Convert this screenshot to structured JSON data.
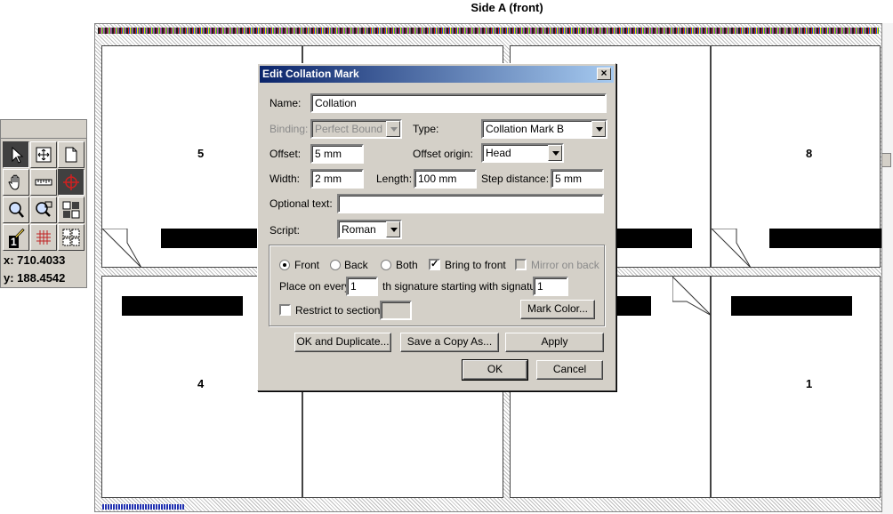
{
  "sheet": {
    "title": "Side A (front)",
    "pages": [
      "5",
      "8",
      "4",
      "1"
    ]
  },
  "tools": {
    "x_readout": "x: 710.4033",
    "y_readout": "y: 188.4542",
    "page_badge": "1"
  },
  "dialog": {
    "title": "Edit Collation Mark",
    "close_glyph": "×",
    "name_label": "Name:",
    "name_value": "Collation",
    "binding_label": "Binding:",
    "binding_value": "Perfect Bound",
    "type_label": "Type:",
    "type_value": "Collation Mark B",
    "offset_label": "Offset:",
    "offset_value": "5 mm",
    "offset_origin_label": "Offset origin:",
    "offset_origin_value": "Head",
    "width_label": "Width:",
    "width_value": "2 mm",
    "length_label": "Length:",
    "length_value": "100 mm",
    "step_label": "Step distance:",
    "step_value": "5 mm",
    "optional_label": "Optional text:",
    "optional_value": "",
    "script_label": "Script:",
    "script_value": "Roman",
    "front_label": "Front",
    "back_label": "Back",
    "both_label": "Both",
    "bring_front_label": "Bring to front",
    "mirror_label": "Mirror on back",
    "place_every_label": "Place on every",
    "place_every_value": "1",
    "th_signature_label": "th signature  starting with signature:",
    "start_sig_value": "1",
    "restrict_label": "Restrict to section:",
    "restrict_value": "",
    "mark_color_label": "Mark Color...",
    "ok_duplicate_label": "OK and Duplicate...",
    "save_copy_label": "Save a Copy As...",
    "apply_label": "Apply",
    "ok_label": "OK",
    "cancel_label": "Cancel"
  }
}
